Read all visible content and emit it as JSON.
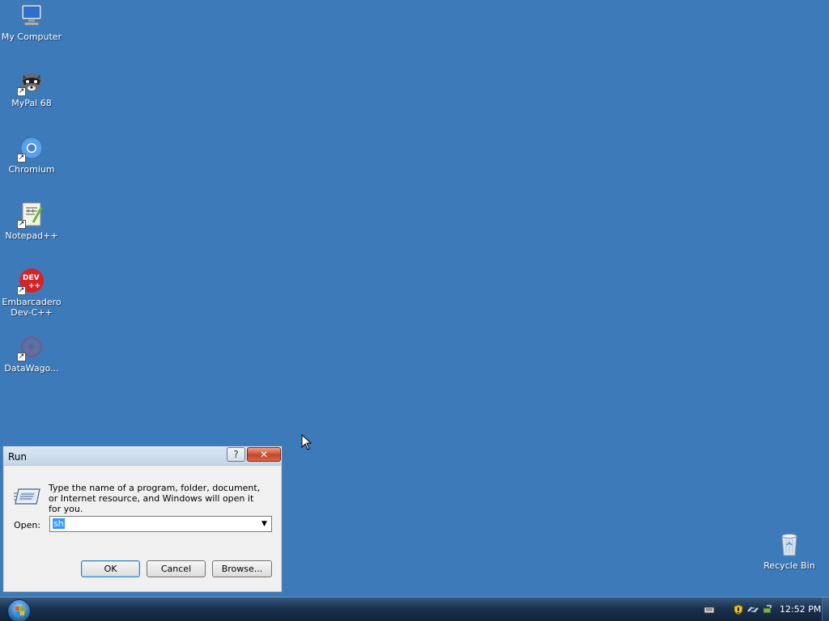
{
  "desktop": {
    "icons": [
      {
        "label": "My Computer",
        "icon": "computer-icon"
      },
      {
        "label": "MyPal 68",
        "icon": "raccoon-icon"
      },
      {
        "label": "Chromium",
        "icon": "chromium-icon"
      },
      {
        "label": "Notepad++",
        "icon": "notepad-icon"
      },
      {
        "label": "Embarcadero\nDev-C++",
        "icon": "devcpp-icon"
      },
      {
        "label": "DataWago...",
        "icon": "datawagon-icon"
      }
    ],
    "recycle_bin": {
      "label": "Recycle Bin",
      "icon": "recycle-bin-icon"
    }
  },
  "run_dialog": {
    "title": "Run",
    "help_label": "?",
    "close_label": "✕",
    "description": "Type the name of a program, folder, document, or Internet resource, and Windows will open it for you.",
    "open_label": "Open:",
    "open_value": "sh",
    "buttons": {
      "ok": "OK",
      "cancel": "Cancel",
      "browse": "Browse..."
    }
  },
  "taskbar": {
    "clock": "12:52 PM",
    "tray_icons": [
      "keyboard-icon",
      "security-shield-icon",
      "network-icon",
      "safely-remove-icon"
    ]
  },
  "colors": {
    "desktop": "#3d7ab9",
    "taskbar": "#1b3150",
    "close_button": "#c9452a",
    "selection": "#3399ff"
  }
}
